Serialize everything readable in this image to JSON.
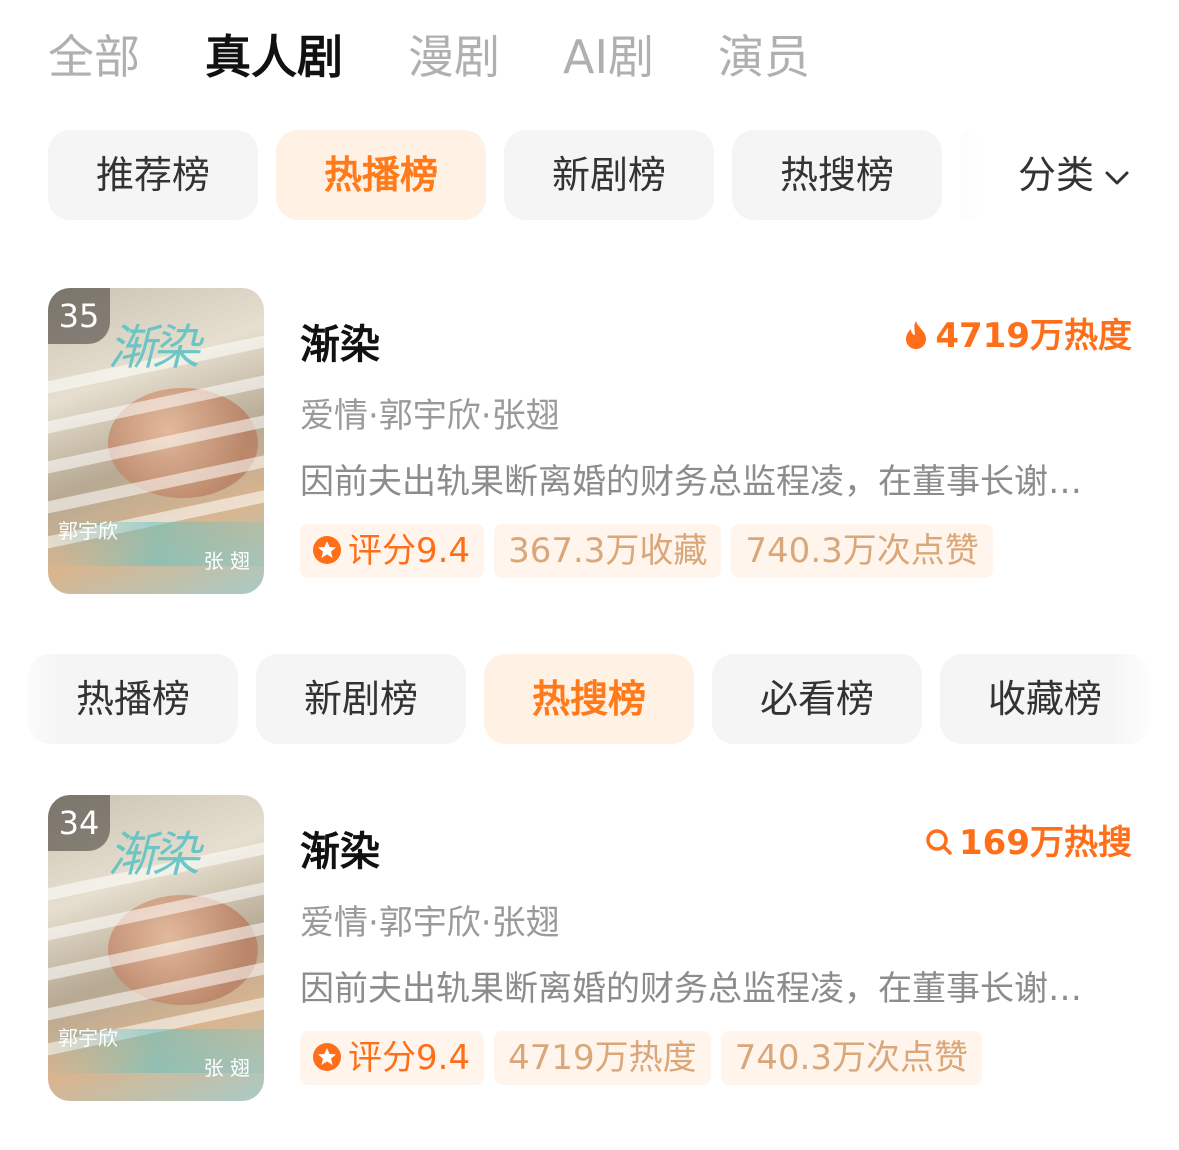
{
  "top_tabs": [
    "全部",
    "真人剧",
    "漫剧",
    "AI剧",
    "演员"
  ],
  "row1_chips": [
    "推荐榜",
    "热播榜",
    "新剧榜",
    "热搜榜"
  ],
  "category_label": "分类",
  "row2_chips": [
    "热播榜",
    "新剧榜",
    "热搜榜",
    "必看榜",
    "收藏榜"
  ],
  "cards": [
    {
      "rank": "35",
      "title": "渐染",
      "metric": "4719万热度",
      "meta": "爱情·郭宇欣·张翅",
      "desc": "因前夫出轨果断离婚的财务总监程凌，在董事长谢…",
      "tags": [
        "评分9.4",
        "367.3万收藏",
        "740.3万次点赞"
      ],
      "poster_names": [
        "郭宇欣",
        "张 翅"
      ]
    },
    {
      "rank": "34",
      "title": "渐染",
      "metric": "169万热搜",
      "meta": "爱情·郭宇欣·张翅",
      "desc": "因前夫出轨果断离婚的财务总监程凌，在董事长谢…",
      "tags": [
        "评分9.4",
        "4719万热度",
        "740.3万次点赞"
      ],
      "poster_names": [
        "郭宇欣",
        "张 翅"
      ]
    }
  ],
  "colors": {
    "accent": "#ff6f1a",
    "chip_active_bg": "#fff1e4",
    "tag_bg": "#fff5ec"
  },
  "icons": {
    "heat": "flame-icon",
    "search": "search-icon",
    "score": "star-badge-icon",
    "category": "chevron-down-icon"
  }
}
